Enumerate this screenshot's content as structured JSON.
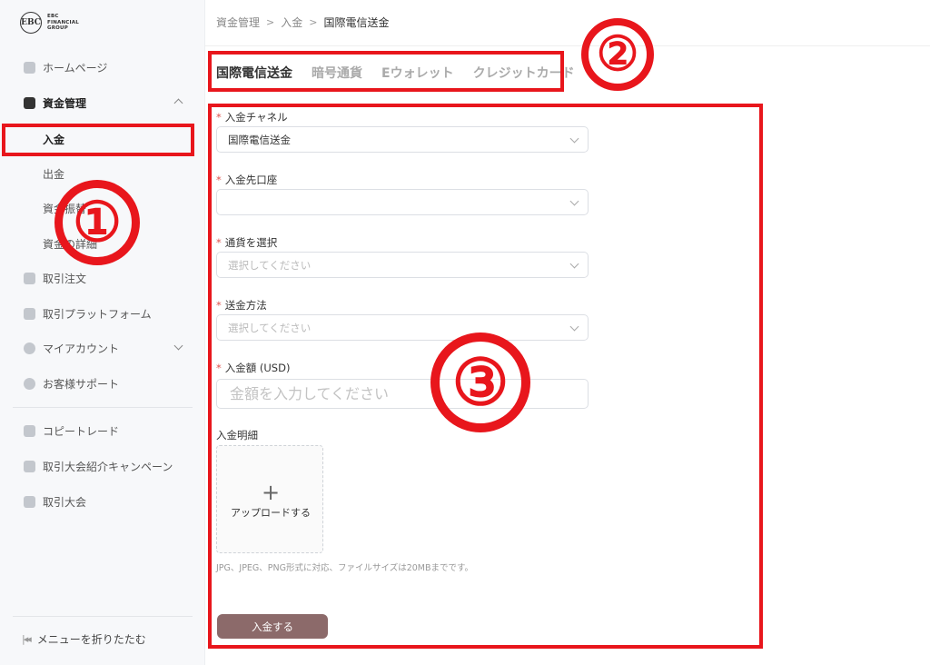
{
  "logo": {
    "mark": "EBC",
    "line1": "EBC",
    "line2": "FINANCIAL",
    "line3": "GROUP"
  },
  "sidebar": {
    "home": "ホームページ",
    "funds": "資金管理",
    "sub": [
      "入金",
      "出金",
      "資金振替",
      "資金の詳細"
    ],
    "orders": "取引注文",
    "platform": "取引プラットフォーム",
    "account": "マイアカウント",
    "support": "お客様サポート",
    "copy": "コピートレード",
    "referral": "取引大会紹介キャンペーン",
    "contest": "取引大会",
    "collapse": "メニューを折りたたむ"
  },
  "breadcrumb": [
    "資金管理",
    "入金",
    "国際電信送金"
  ],
  "tabs": [
    "国際電信送金",
    "暗号通貨",
    "Eウォレット",
    "クレジットカード"
  ],
  "form": {
    "channel_label": "入金チャネル",
    "channel_value": "国際電信送金",
    "account_label": "入金先口座",
    "account_value": "",
    "currency_label": "通貨を選択",
    "currency_placeholder": "選択してください",
    "method_label": "送金方法",
    "method_placeholder": "選択してください",
    "amount_label": "入金額 (USD)",
    "amount_placeholder": "金額を入力してください",
    "detail_label": "入金明細",
    "upload_label": "アップロードする",
    "hint": "JPG、JPEG、PNG形式に対応、ファイルサイズは20MBまでです。",
    "submit": "入金する"
  },
  "annotations": [
    "①",
    "②",
    "③"
  ],
  "colors": {
    "annotation": "#e8161c",
    "accent": "#8c6a6a",
    "required": "#e0524c"
  }
}
